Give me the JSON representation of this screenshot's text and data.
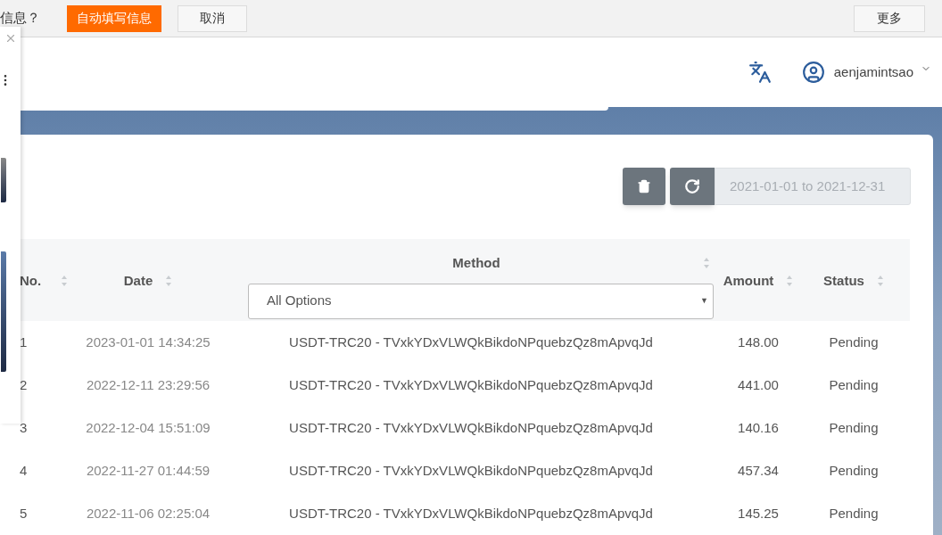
{
  "autofill_bar": {
    "prompt": "信息？",
    "fill_button": "自动填写信息",
    "cancel_button": "取消",
    "more_button": "更多"
  },
  "header": {
    "username": "aenjamintsao"
  },
  "toolbar": {
    "date_range": "2021-01-01 to 2021-12-31"
  },
  "table": {
    "columns": [
      {
        "label": "No.",
        "sortable": true
      },
      {
        "label": "Date",
        "sortable": true
      },
      {
        "label": "Method",
        "sortable": true
      },
      {
        "label": "Amount",
        "sortable": true
      },
      {
        "label": "Status",
        "sortable": true
      }
    ],
    "method_filter": "All Options",
    "method_filter_arrow": "▼",
    "rows": [
      {
        "no": "1",
        "date": "2023-01-01 14:34:25",
        "method": "USDT-TRC20 - TVxkYDxVLWQkBikdoNPquebzQz8mApvqJd",
        "amount": "148.00",
        "status": "Pending"
      },
      {
        "no": "2",
        "date": "2022-12-11 23:29:56",
        "method": "USDT-TRC20 - TVxkYDxVLWQkBikdoNPquebzQz8mApvqJd",
        "amount": "441.00",
        "status": "Pending"
      },
      {
        "no": "3",
        "date": "2022-12-04 15:51:09",
        "method": "USDT-TRC20 - TVxkYDxVLWQkBikdoNPquebzQz8mApvqJd",
        "amount": "140.16",
        "status": "Pending"
      },
      {
        "no": "4",
        "date": "2022-11-27 01:44:59",
        "method": "USDT-TRC20 - TVxkYDxVLWQkBikdoNPquebzQz8mApvqJd",
        "amount": "457.34",
        "status": "Pending"
      },
      {
        "no": "5",
        "date": "2022-11-06 02:25:04",
        "method": "USDT-TRC20 - TVxkYDxVLWQkBikdoNPquebzQz8mApvqJd",
        "amount": "145.25",
        "status": "Pending"
      }
    ]
  }
}
